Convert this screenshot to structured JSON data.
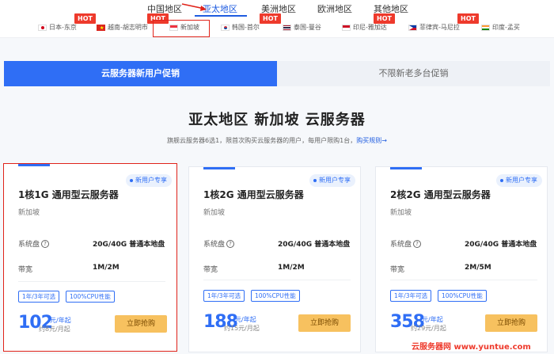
{
  "region_tabs": [
    {
      "label": "中国地区",
      "active": false
    },
    {
      "label": "亚太地区",
      "active": true
    },
    {
      "label": "美洲地区",
      "active": false
    },
    {
      "label": "欧洲地区",
      "active": false
    },
    {
      "label": "其他地区",
      "active": false
    }
  ],
  "hot_label": "HOT",
  "countries": [
    {
      "label": "日本-东京",
      "hot": false
    },
    {
      "label": "越南-胡志明市",
      "hot": true
    },
    {
      "label": "新加坡",
      "hot": true,
      "selected": true
    },
    {
      "label": "韩国-首尔",
      "hot": false
    },
    {
      "label": "泰国-曼谷",
      "hot": true
    },
    {
      "label": "印尼-雅加达",
      "hot": false
    },
    {
      "label": "菲律宾-马尼拉",
      "hot": true
    },
    {
      "label": "印度-孟买",
      "hot": true
    }
  ],
  "promo_tabs": {
    "active": "云服务器新用户促销",
    "inactive": "不限新老多台促销"
  },
  "section": {
    "title": "亚太地区 新加坡 云服务器",
    "subtitle": "旗舰云服务器6选1，限首次购买云服务器的用户，每用户限购1台，",
    "rules_link": "购买规则→"
  },
  "cards": [
    {
      "badge": "新用户专享",
      "title": "1核1G 通用型云服务器",
      "region": "新加坡",
      "disk_label": "系统盘",
      "disk_value": "20G/40G 普通本地盘",
      "bw_label": "带宽",
      "bw_value": "1M/2M",
      "tag1": "1年/3年可选",
      "tag2": "100%CPU性能",
      "price": "102",
      "price_unit": "元/年起",
      "price_sub": "约8元/月起",
      "buy": "立即抢购",
      "selected": true
    },
    {
      "badge": "新用户专享",
      "title": "1核2G 通用型云服务器",
      "region": "新加坡",
      "disk_label": "系统盘",
      "disk_value": "20G/40G 普通本地盘",
      "bw_label": "带宽",
      "bw_value": "1M/2M",
      "tag1": "1年/3年可选",
      "tag2": "100%CPU性能",
      "price": "188",
      "price_unit": "元/年起",
      "price_sub": "约15元/月起",
      "buy": "立即抢购",
      "selected": false
    },
    {
      "badge": "新用户专享",
      "title": "2核2G 通用型云服务器",
      "region": "新加坡",
      "disk_label": "系统盘",
      "disk_value": "20G/40G 普通本地盘",
      "bw_label": "带宽",
      "bw_value": "2M/5M",
      "tag1": "1年/3年可选",
      "tag2": "100%CPU性能",
      "price": "358",
      "price_unit": "元/年起",
      "price_sub": "约29元/月起",
      "buy": "立即抢购",
      "selected": false
    }
  ],
  "watermark": "云服务器网 www.yuntue.com",
  "colors": {
    "accent": "#2f6ef5",
    "hot": "#ee3a2c",
    "highlight": "#e0231a",
    "buy_button": "#f7c15f"
  }
}
